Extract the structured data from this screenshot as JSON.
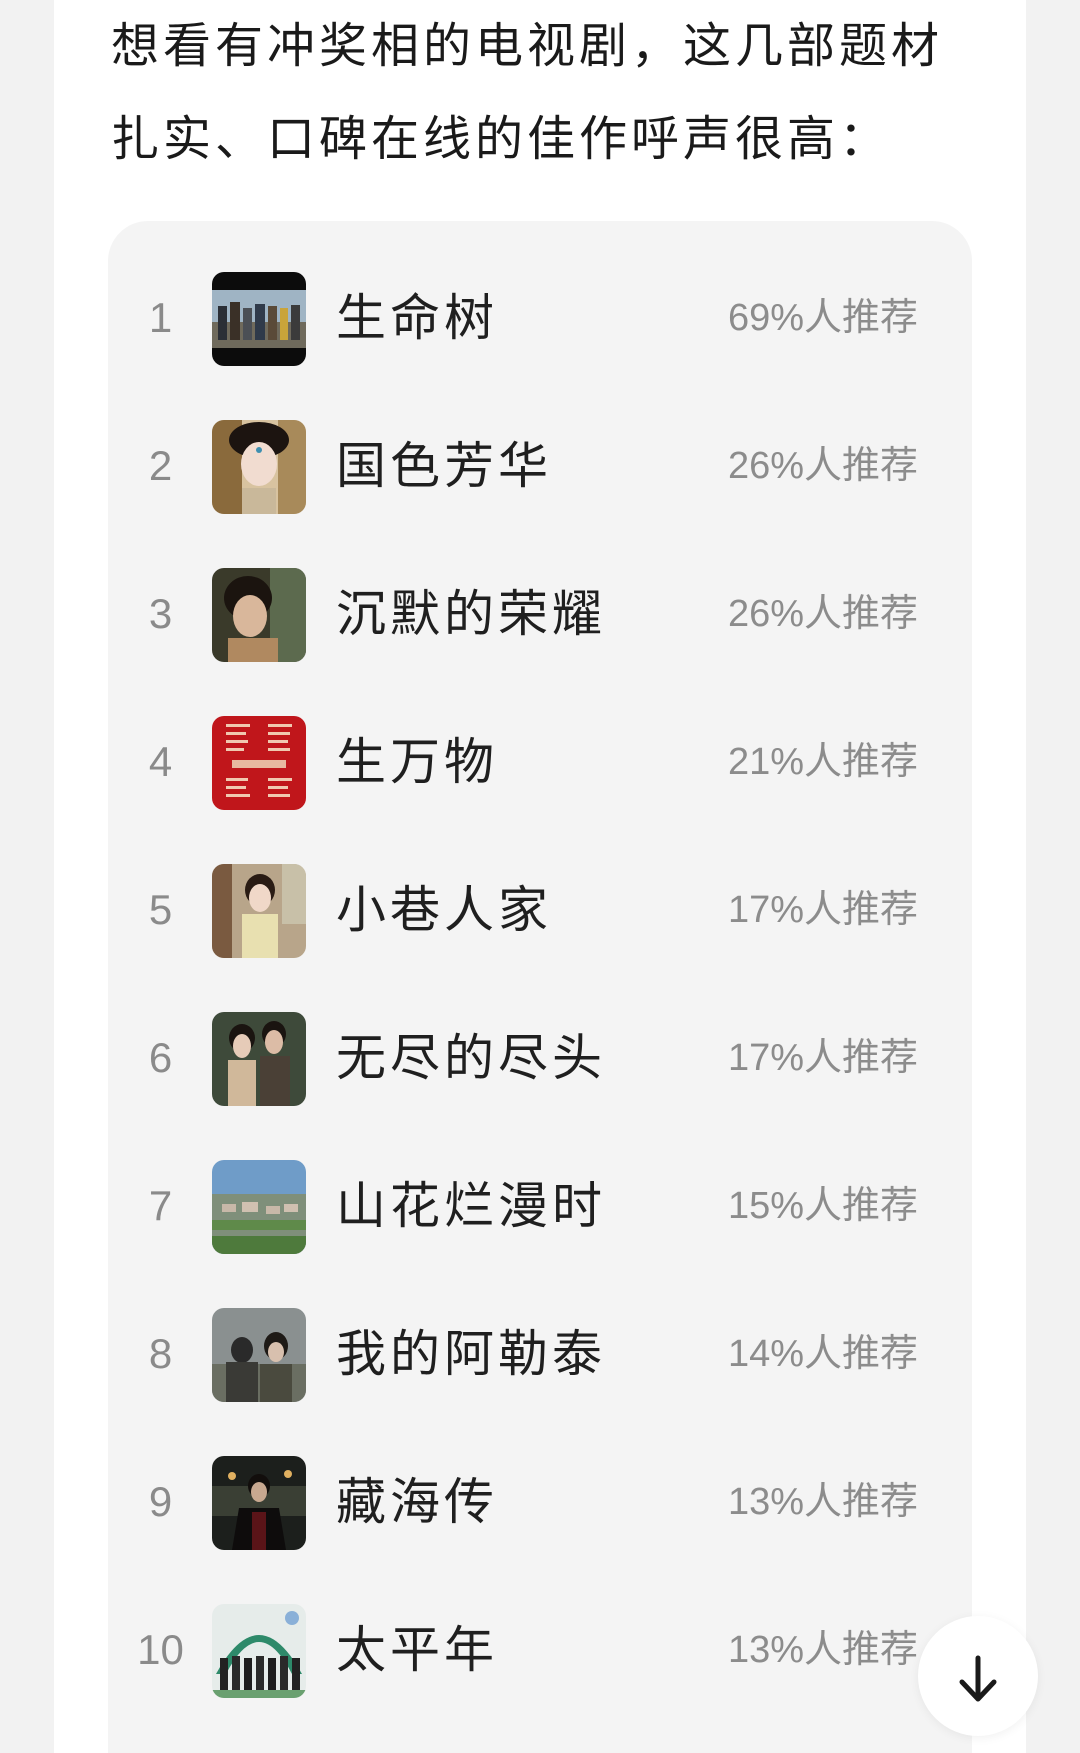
{
  "intro": {
    "line1": "想看有冲奖相的电视剧，这几部题材",
    "line2": "扎实、口碑在线的佳作呼声很高："
  },
  "ranking": [
    {
      "rank": "1",
      "title": "生命树",
      "percent": "69%人推荐"
    },
    {
      "rank": "2",
      "title": "国色芳华",
      "percent": "26%人推荐"
    },
    {
      "rank": "3",
      "title": "沉默的荣耀",
      "percent": "26%人推荐"
    },
    {
      "rank": "4",
      "title": "生万物",
      "percent": "21%人推荐"
    },
    {
      "rank": "5",
      "title": "小巷人家",
      "percent": "17%人推荐"
    },
    {
      "rank": "6",
      "title": "无尽的尽头",
      "percent": "17%人推荐"
    },
    {
      "rank": "7",
      "title": "山花烂漫时",
      "percent": "15%人推荐"
    },
    {
      "rank": "8",
      "title": "我的阿勒泰",
      "percent": "14%人推荐"
    },
    {
      "rank": "9",
      "title": "藏海传",
      "percent": "13%人推荐"
    },
    {
      "rank": "10",
      "title": "太平年",
      "percent": "13%人推荐"
    }
  ],
  "scroll_button": {
    "icon": "arrow-down-icon"
  }
}
